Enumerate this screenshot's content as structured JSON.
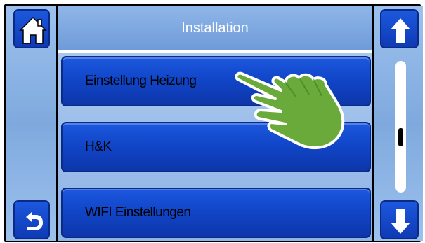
{
  "header": {
    "title": "Installation"
  },
  "menu": {
    "items": [
      {
        "label": "Einstellung Heizung"
      },
      {
        "label": "H&K"
      },
      {
        "label": "WIFI Einstellungen"
      }
    ]
  },
  "icons": {
    "home": "home-icon",
    "back": "back-arrow-icon",
    "up": "arrow-up-icon",
    "down": "arrow-down-icon",
    "pointer": "pointing-hand-icon"
  },
  "colors": {
    "button_blue": "#1146c9",
    "panel_blue": "#8fb4e6",
    "hand_green": "#6aaa3a"
  }
}
